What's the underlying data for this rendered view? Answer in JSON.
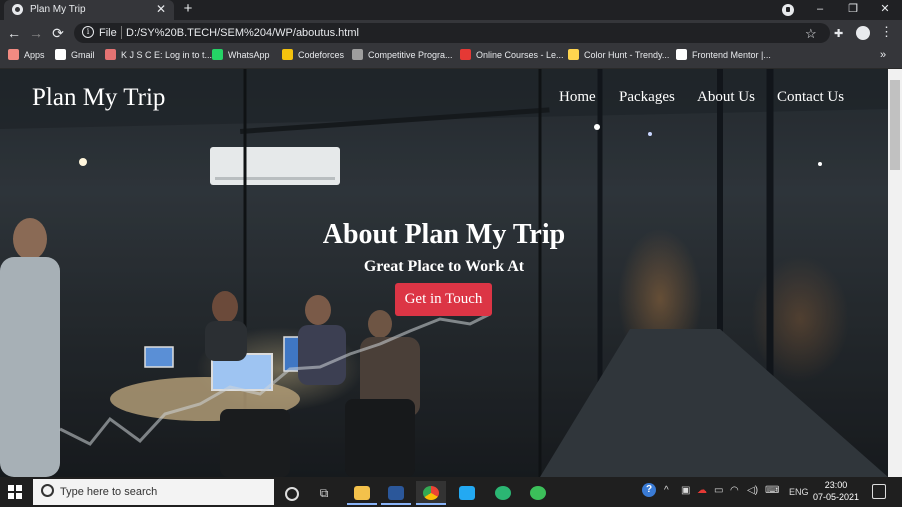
{
  "browser": {
    "tab_title": "Plan My Trip",
    "new_tab": "+",
    "address_prefix": "File",
    "url": "D:/SY%20B.TECH/SEM%204/WP/aboutus.html",
    "window_controls": {
      "minimize": "–",
      "restore": "❐",
      "close": "✕"
    }
  },
  "bookmarks": [
    {
      "label": "Apps",
      "icon": "apps-grid-icon",
      "color": "#f28b82"
    },
    {
      "label": "Gmail",
      "icon": "google-icon",
      "color": "#ffffff"
    },
    {
      "label": "K J S C E: Log in to t...",
      "icon": "kjsce-icon",
      "color": "#e57373"
    },
    {
      "label": "WhatsApp",
      "icon": "whatsapp-icon",
      "color": "#25d366"
    },
    {
      "label": "Codeforces",
      "icon": "codeforces-icon",
      "color": "#f4c20d"
    },
    {
      "label": "Competitive Progra...",
      "icon": "cc-icon",
      "color": "#9e9e9e"
    },
    {
      "label": "Online Courses - Le...",
      "icon": "courses-icon",
      "color": "#e53935"
    },
    {
      "label": "Color Hunt - Trendy...",
      "icon": "colorhunt-icon",
      "color": "#ffd54f"
    },
    {
      "label": "Frontend Mentor |...",
      "icon": "frontendmentor-icon",
      "color": "#ffffff"
    }
  ],
  "bookmarks_overflow": "»",
  "site": {
    "brand": "Plan My Trip",
    "nav": [
      "Home",
      "Packages",
      "About Us",
      "Contact Us"
    ],
    "hero_title": "About Plan My Trip",
    "hero_subtitle": "Great Place to Work At",
    "cta_label": "Get in Touch",
    "cta_color": "#dc3545"
  },
  "taskbar": {
    "search_placeholder": "Type here to search",
    "apps": [
      "task-view-icon",
      "file-explorer-icon",
      "word-icon",
      "chrome-icon",
      "vscode-icon",
      "app-green-icon",
      "app-round-icon"
    ],
    "language": "ENG",
    "time": "23:00",
    "date": "07-05-2021"
  }
}
